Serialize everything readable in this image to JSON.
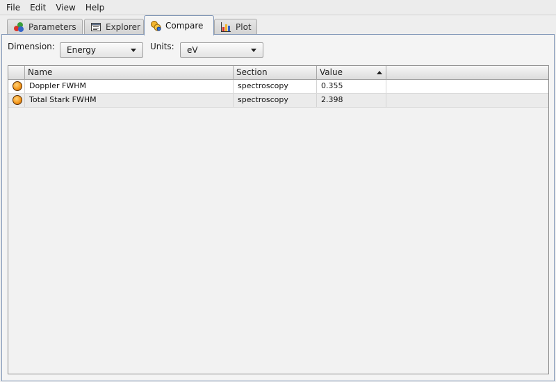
{
  "menu": [
    "File",
    "Edit",
    "View",
    "Help"
  ],
  "tabs": [
    {
      "label": "Parameters",
      "icon": "parameters-icon"
    },
    {
      "label": "Explorer",
      "icon": "explorer-icon"
    },
    {
      "label": "Compare",
      "icon": "compare-icon",
      "active": true
    },
    {
      "label": "Plot",
      "icon": "plot-icon"
    }
  ],
  "compare": {
    "dimension_label": "Dimension:",
    "dimension_value": "Energy",
    "units_label": "Units:",
    "units_value": "eV"
  },
  "table": {
    "columns": [
      "",
      "Name",
      "Section",
      "Value"
    ],
    "sorted_column": "Value",
    "sort_direction": "ascending",
    "rows": [
      {
        "status_icon": "orange-orb-icon",
        "name": "Doppler FWHM",
        "section": "spectroscopy",
        "value": "0.355"
      },
      {
        "status_icon": "orange-orb-icon",
        "name": "Total Stark FWHM",
        "section": "spectroscopy",
        "value": "2.398"
      }
    ]
  },
  "colors": {
    "accent_border": "#7f95b6",
    "status_orb": "#f59a1e"
  }
}
